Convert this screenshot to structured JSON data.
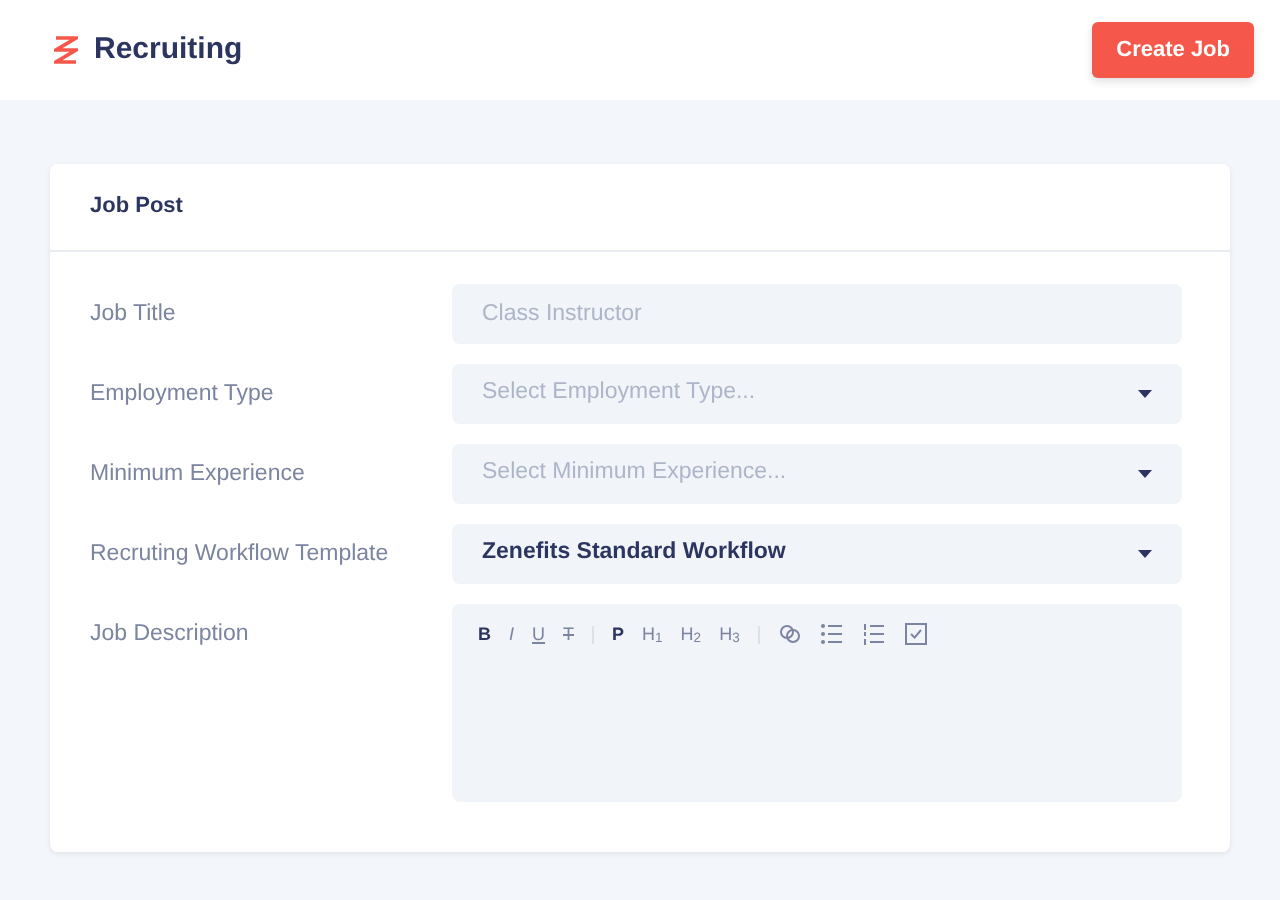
{
  "app": {
    "title": "Recruiting"
  },
  "create_button": "Create Job",
  "card": {
    "title": "Job Post"
  },
  "fields": [
    {
      "label": "Job Title",
      "kind": "text",
      "placeholder": "Class Instructor"
    },
    {
      "label": "Employment Type",
      "kind": "select",
      "placeholder": "Select Employment Type..."
    },
    {
      "label": "Minimum Experience",
      "kind": "select",
      "placeholder": "Select Minimum Experience..."
    },
    {
      "label": "Recruting Workflow Template",
      "kind": "select",
      "value": "Zenefits Standard Workflow"
    },
    {
      "label": "Job Description",
      "kind": "editor"
    }
  ],
  "editor_toolbar": [
    {
      "kind": "bold",
      "label": "B"
    },
    {
      "kind": "italic",
      "label": "I"
    },
    {
      "kind": "underline",
      "label": "U"
    },
    {
      "kind": "strike",
      "label": "T"
    },
    {
      "kind": "divider"
    },
    {
      "kind": "bold",
      "label": "P"
    },
    {
      "kind": "plain",
      "label": "H$_{1}$"
    },
    {
      "kind": "plain",
      "label": "H$_{2}$"
    },
    {
      "kind": "plain",
      "label": "H$_{3}$"
    },
    {
      "kind": "divider"
    },
    {
      "kind": "link"
    },
    {
      "kind": "bullets"
    },
    {
      "kind": "numbers"
    },
    {
      "kind": "checkbox"
    }
  ]
}
